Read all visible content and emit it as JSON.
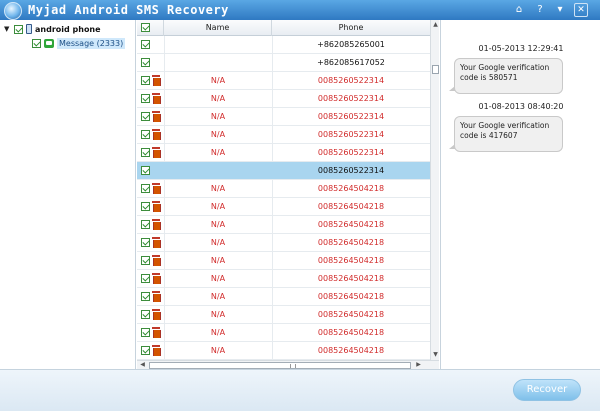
{
  "window": {
    "title": "Myjad Android SMS Recovery",
    "buttons": {
      "home": "⌂",
      "help": "?",
      "menu": "▾",
      "close": "✕"
    }
  },
  "tree": {
    "device": "android phone",
    "message_node": "Message (2333)"
  },
  "table": {
    "columns": {
      "name": "Name",
      "phone": "Phone"
    },
    "rows": [
      {
        "name": "",
        "phone": "+862085265001",
        "deleted": false,
        "selected": false
      },
      {
        "name": "",
        "phone": "+862085617052",
        "deleted": false,
        "selected": false
      },
      {
        "name": "N/A",
        "phone": "0085260522314",
        "deleted": true,
        "selected": false
      },
      {
        "name": "N/A",
        "phone": "0085260522314",
        "deleted": true,
        "selected": false
      },
      {
        "name": "N/A",
        "phone": "0085260522314",
        "deleted": true,
        "selected": false
      },
      {
        "name": "N/A",
        "phone": "0085260522314",
        "deleted": true,
        "selected": false
      },
      {
        "name": "N/A",
        "phone": "0085260522314",
        "deleted": true,
        "selected": false
      },
      {
        "name": "",
        "phone": "0085260522314",
        "deleted": false,
        "selected": true
      },
      {
        "name": "N/A",
        "phone": "0085264504218",
        "deleted": true,
        "selected": false
      },
      {
        "name": "N/A",
        "phone": "0085264504218",
        "deleted": true,
        "selected": false
      },
      {
        "name": "N/A",
        "phone": "0085264504218",
        "deleted": true,
        "selected": false
      },
      {
        "name": "N/A",
        "phone": "0085264504218",
        "deleted": true,
        "selected": false
      },
      {
        "name": "N/A",
        "phone": "0085264504218",
        "deleted": true,
        "selected": false
      },
      {
        "name": "N/A",
        "phone": "0085264504218",
        "deleted": true,
        "selected": false
      },
      {
        "name": "N/A",
        "phone": "0085264504218",
        "deleted": true,
        "selected": false
      },
      {
        "name": "N/A",
        "phone": "0085264504218",
        "deleted": true,
        "selected": false
      },
      {
        "name": "N/A",
        "phone": "0085264504218",
        "deleted": true,
        "selected": false
      },
      {
        "name": "N/A",
        "phone": "0085264504218",
        "deleted": true,
        "selected": false
      },
      {
        "name": "N/A",
        "phone": "0085264504218",
        "deleted": true,
        "selected": false
      },
      {
        "name": "N/A",
        "phone": "0085264504218",
        "deleted": true,
        "selected": false
      }
    ]
  },
  "messages": [
    {
      "timestamp": "01-05-2013 12:29:41",
      "text": "Your Google verification code is 580571"
    },
    {
      "timestamp": "01-08-2013 08:40:20",
      "text": "Your Google verification code is 417607"
    }
  ],
  "footer": {
    "recover_label": "Recover"
  },
  "colors": {
    "deleted_text": "#d12b2b",
    "selection": "#a9d5ef",
    "title_bar": "#3a86cc"
  }
}
